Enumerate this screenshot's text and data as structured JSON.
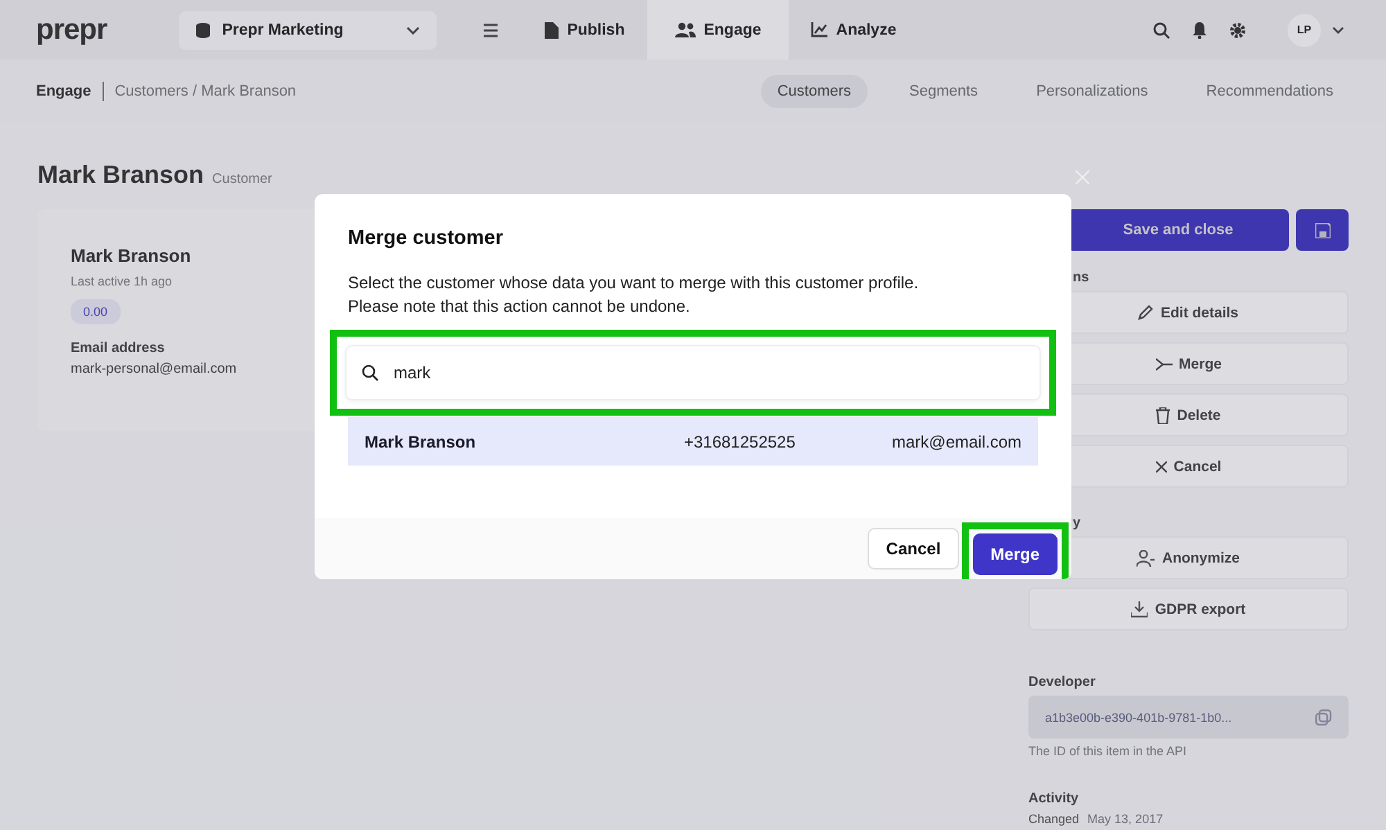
{
  "topbar": {
    "logo": "prepr",
    "workspace": "Prepr Marketing",
    "nav": [
      {
        "label": "Publish",
        "selected": false
      },
      {
        "label": "Engage",
        "selected": true
      },
      {
        "label": "Analyze",
        "selected": false
      }
    ],
    "avatar": "LP"
  },
  "subbar": {
    "section": "Engage",
    "path": "Customers / Mark Branson",
    "tabs": [
      {
        "label": "Customers",
        "selected": true
      },
      {
        "label": "Segments",
        "selected": false
      },
      {
        "label": "Personalizations",
        "selected": false
      },
      {
        "label": "Recommendations",
        "selected": false
      }
    ]
  },
  "page": {
    "title": "Mark Branson",
    "subtitle": "Customer",
    "card": {
      "name": "Mark Branson",
      "last_active": "Last active 1h ago",
      "score": "0.00",
      "email_label": "Email address",
      "email": "mark-personal@email.com"
    }
  },
  "sidebar": {
    "save_button": "Save and close",
    "sections": [
      {
        "title": "ns",
        "buttons": [
          "Edit details",
          "Merge",
          "Delete",
          "Cancel"
        ]
      },
      {
        "title": "y",
        "buttons": [
          "Anonymize",
          "GDPR export"
        ]
      }
    ],
    "developer": {
      "title": "Developer",
      "id": "a1b3e00b-e390-401b-9781-1b0...",
      "hint": "The ID of this item in the API"
    },
    "activity": {
      "title": "Activity",
      "changed_label": "Changed",
      "changed_value": "May 13, 2017"
    }
  },
  "modal": {
    "title": "Merge customer",
    "description": [
      "Select the customer whose data you want to merge with this customer profile.",
      "Please note that this action cannot be undone."
    ],
    "search": {
      "value": "mark",
      "highlighted": true
    },
    "results": [
      {
        "name": "Mark Branson",
        "phone": "+31681252525",
        "email": "mark@email.com",
        "selected": true
      }
    ],
    "cancel": "Cancel",
    "merge": {
      "label": "Merge",
      "highlighted": true
    }
  }
}
